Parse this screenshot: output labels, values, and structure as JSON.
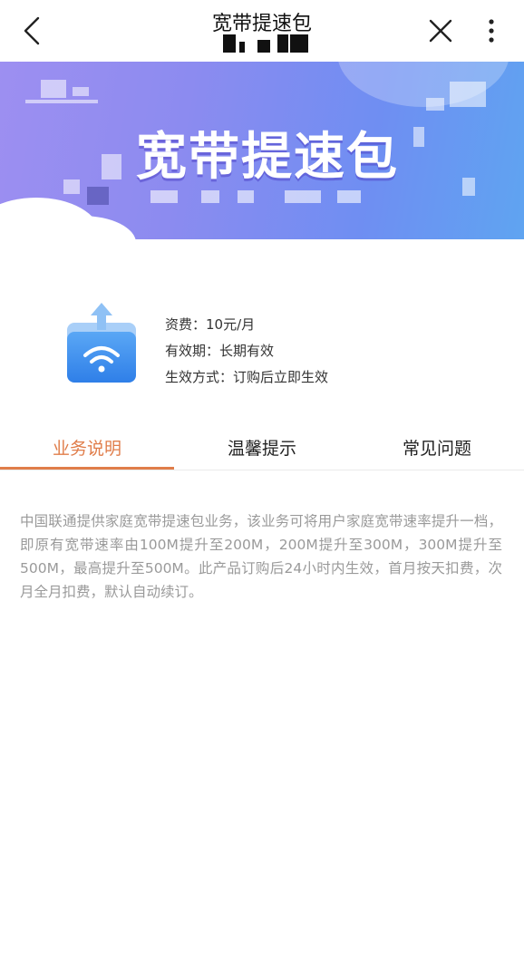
{
  "header": {
    "title": "宽带提速包",
    "back_icon": "chevron-left-icon",
    "close_icon": "close-icon",
    "more_icon": "more-vertical-icon"
  },
  "banner": {
    "title": "宽带提速包",
    "colors": [
      "#9d8ff1",
      "#6f8ef2",
      "#5fa4f1"
    ]
  },
  "product": {
    "icon": "folder-wifi-icon",
    "fee": "资费：10元/月",
    "validity": "有效期：长期有效",
    "activation": "生效方式：订购后立即生效"
  },
  "tabs": [
    {
      "label": "业务说明",
      "active": true
    },
    {
      "label": "温馨提示",
      "active": false
    },
    {
      "label": "常见问题",
      "active": false
    }
  ],
  "accent_color": "#e07d4a",
  "description": "中国联通提供家庭宽带提速包业务，该业务可将用户家庭宽带速率提升一档，即原有宽带速率由100M提升至200M，200M提升至300M，300M提升至500M，最高提升至500M。此产品订购后24小时内生效，首月按天扣费，次月全月扣费，默认自动续订。"
}
